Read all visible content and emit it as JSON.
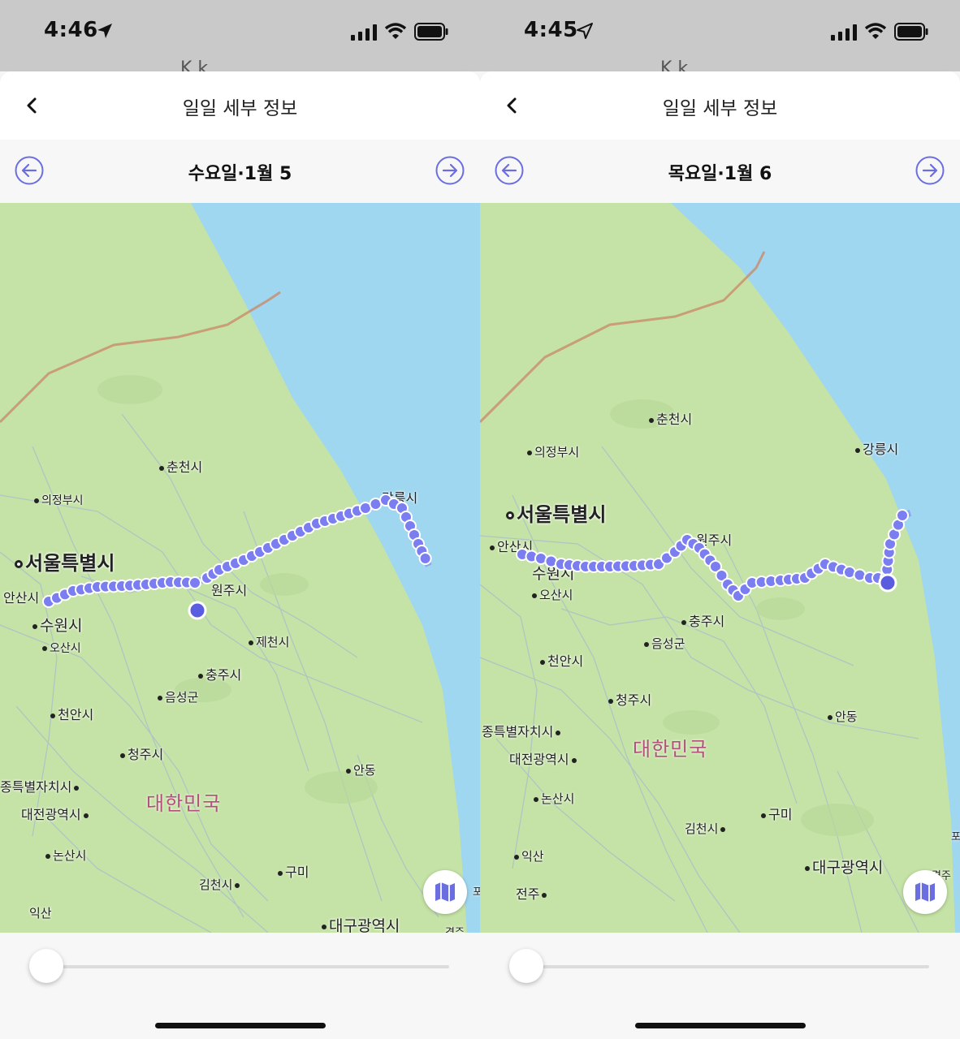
{
  "panels": [
    {
      "status": {
        "time": "4:46"
      },
      "behind_text": "K    k",
      "header": {
        "title": "일일 세부 정보"
      },
      "date_label": "수요일·1월 5",
      "map": {
        "labels": {
          "chuncheon": "춘천시",
          "uijeongbu": "의정부시",
          "seoul": "서울특별시",
          "ansan": "안산시",
          "suwon": "수원시",
          "osan": "오산시",
          "wonju": "원주시",
          "gangneung": "강릉시",
          "jecheon": "제천시",
          "chungju": "충주시",
          "eumseong": "음성군",
          "cheonan": "천안시",
          "cheongju": "청주시",
          "sejong": "종특별자치시",
          "daejeon": "대전광역시",
          "country": "대한민국",
          "andong": "안동",
          "nonsan": "논산시",
          "gumi": "구미",
          "gimcheon": "김천시",
          "iksan": "익산",
          "daegu": "대구광역시",
          "gyeongju": "경주",
          "pohang": "포"
        }
      },
      "slider": {
        "value": 0
      }
    },
    {
      "status": {
        "time": "4:45"
      },
      "behind_text": "K    k",
      "header": {
        "title": "일일 세부 정보"
      },
      "date_label": "목요일·1월 6",
      "map": {
        "labels": {
          "chuncheon": "춘천시",
          "uijeongbu": "의정부시",
          "gangneung": "강릉시",
          "seoul": "서울특별시",
          "ansan": "안산시",
          "suwon": "수원시",
          "osan": "오산시",
          "wonju": "원주시",
          "chungju": "충주시",
          "eumseong": "음성군",
          "cheonan": "천안시",
          "cheongju": "청주시",
          "andong": "안동",
          "sejong": "종특별자치시",
          "daejeon": "대전광역시",
          "country": "대한민국",
          "nonsan": "논산시",
          "gumi": "구미",
          "gimcheon": "김천시",
          "iksan": "익산",
          "daegu": "대구광역시",
          "jeonju": "전주",
          "gyeongju": "경주",
          "pohang": "포"
        }
      },
      "slider": {
        "value": 0
      }
    }
  ],
  "colors": {
    "accent": "#6b6ee0",
    "route_fill": "#7b7ef0",
    "sea": "#9fd6f0",
    "land": "#c5e3a6",
    "country_label": "#b2507a",
    "border": "#c98b6a"
  },
  "icons": [
    "location-arrow-icon",
    "signal-icon",
    "wifi-icon",
    "battery-icon",
    "chevron-left-icon",
    "arrow-left-circle-icon",
    "arrow-right-circle-icon",
    "map-icon"
  ]
}
